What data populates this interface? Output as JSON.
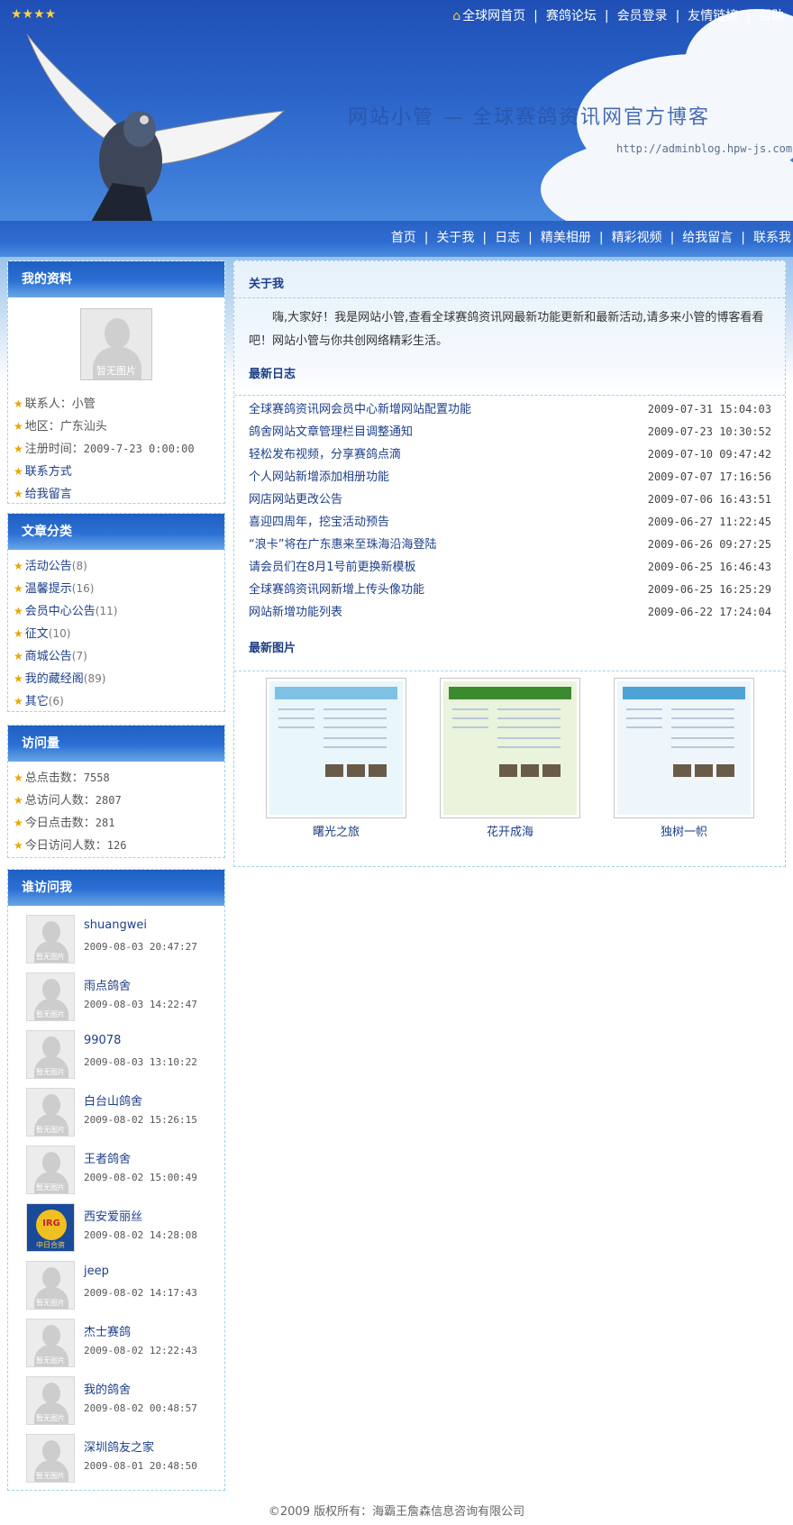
{
  "header": {
    "stars": "★★★★",
    "top_nav": [
      "全球网首页",
      "赛鸽论坛",
      "会员登录",
      "友情链接",
      "帮助"
    ],
    "site_title": "网站小管 — 全球赛鸽资讯网官方博客",
    "site_url": "http://adminblog.hpw-js.com/",
    "main_nav": [
      "首页",
      "关于我",
      "日志",
      "精美相册",
      "精彩视频",
      "给我留言",
      "联系我"
    ]
  },
  "profile": {
    "title": "我的资料",
    "avatar_caption": "暂无图片",
    "items": [
      {
        "label": "联系人：",
        "value": "小管"
      },
      {
        "label": "地区：",
        "value": "广东汕头"
      },
      {
        "label": "注册时间：",
        "value": "2009-7-23 0:00:00"
      },
      {
        "label": "联系方式",
        "value": ""
      },
      {
        "label": "给我留言",
        "value": ""
      }
    ]
  },
  "categories": {
    "title": "文章分类",
    "items": [
      {
        "name": "活动公告",
        "count": "(8)"
      },
      {
        "name": "温馨提示",
        "count": "(16)"
      },
      {
        "name": "会员中心公告",
        "count": "(11)"
      },
      {
        "name": "征文",
        "count": "(10)"
      },
      {
        "name": "商城公告",
        "count": "(7)"
      },
      {
        "name": "我的藏经阁",
        "count": "(89)"
      },
      {
        "name": "其它",
        "count": "(6)"
      }
    ]
  },
  "visits": {
    "title": "访问量",
    "items": [
      {
        "label": "总点击数：",
        "value": "7558"
      },
      {
        "label": "总访问人数：",
        "value": "2807"
      },
      {
        "label": "今日点击数：",
        "value": "281"
      },
      {
        "label": "今日访问人数：",
        "value": "126"
      }
    ]
  },
  "visitors": {
    "title": "谁访问我",
    "avatar_caption": "暂无图片",
    "items": [
      {
        "name": "shuangwei",
        "time": "2009-08-03 20:47:27"
      },
      {
        "name": "雨点鸽舍",
        "time": "2009-08-03 14:22:47"
      },
      {
        "name": "99078",
        "time": "2009-08-03 13:10:22"
      },
      {
        "name": "白台山鸽舍",
        "time": "2009-08-02 15:26:15"
      },
      {
        "name": "王者鸽舍",
        "time": "2009-08-02 15:00:49"
      },
      {
        "name": "西安爱丽丝",
        "time": "2009-08-02 14:28:08",
        "logo_text": "中日合资",
        "logo_mark": "IRG"
      },
      {
        "name": "jeep",
        "time": "2009-08-02 14:17:43"
      },
      {
        "name": "杰士赛鸽",
        "time": "2009-08-02 12:22:43"
      },
      {
        "name": "我的鸽舍",
        "time": "2009-08-02 00:48:57"
      },
      {
        "name": "深圳鸽友之家",
        "time": "2009-08-01 20:48:50"
      }
    ]
  },
  "about": {
    "title": "关于我",
    "intro": "嗨,大家好！我是网站小管,查看全球赛鸽资讯网最新功能更新和最新活动,请多来小管的博客看看吧！网站小管与你共创网络精彩生活。"
  },
  "latest_posts": {
    "title": "最新日志",
    "items": [
      {
        "title": "全球赛鸽资讯网会员中心新增网站配置功能",
        "date": "2009-07-31 15:04:03"
      },
      {
        "title": "鸽舍网站文章管理栏目调整通知",
        "date": "2009-07-23 10:30:52"
      },
      {
        "title": "轻松发布视频，分享赛鸽点滴",
        "date": "2009-07-10 09:47:42"
      },
      {
        "title": "个人网站新增添加相册功能",
        "date": "2009-07-07 17:16:56"
      },
      {
        "title": "网店网站更改公告",
        "date": "2009-07-06 16:43:51"
      },
      {
        "title": "喜迎四周年，挖宝活动预告",
        "date": "2009-06-27 11:22:45"
      },
      {
        "title": "“浪卡”将在广东惠来至珠海沿海登陆",
        "date": "2009-06-26 09:27:25"
      },
      {
        "title": "请会员们在8月1号前更换新模板",
        "date": "2009-06-25 16:46:43"
      },
      {
        "title": "全球赛鸽资讯网新增上传头像功能",
        "date": "2009-06-25 16:25:29"
      },
      {
        "title": "网站新增功能列表",
        "date": "2009-06-22 17:24:04"
      }
    ]
  },
  "latest_pics": {
    "title": "最新图片",
    "items": [
      {
        "caption": "曙光之旅",
        "theme": "#e9f6fb",
        "accent": "#7fc1e4"
      },
      {
        "caption": "花开成海",
        "theme": "#eaf3dc",
        "accent": "#3c8a2e"
      },
      {
        "caption": "独树一帜",
        "theme": "#eef6fb",
        "accent": "#4ea2d6"
      }
    ]
  },
  "footer": {
    "copyright": "©2009 版权所有：海霸王詹森信息咨询有限公司"
  }
}
